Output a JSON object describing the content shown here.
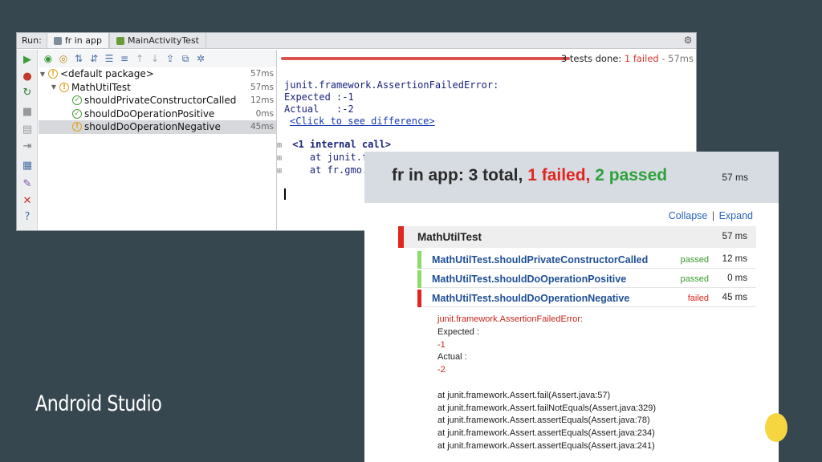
{
  "ide": {
    "run_label": "Run:",
    "tabs": [
      {
        "label": "fr in app"
      },
      {
        "label": "MainActivityTest"
      }
    ],
    "tree": [
      {
        "label": "<default package>",
        "duration": "57ms",
        "level": 0,
        "status": "warn"
      },
      {
        "label": "MathUtilTest",
        "duration": "57ms",
        "level": 1,
        "status": "warn"
      },
      {
        "label": "shouldPrivateConstructorCalled",
        "duration": "12ms",
        "level": 2,
        "status": "ok"
      },
      {
        "label": "shouldDoOperationPositive",
        "duration": "0ms",
        "level": 2,
        "status": "ok"
      },
      {
        "label": "shouldDoOperationNegative",
        "duration": "45ms",
        "level": 2,
        "status": "warn"
      }
    ],
    "progress": {
      "done_text": "3 tests done:",
      "failed_text": "1 failed",
      "time_text": "- 57ms",
      "colors": {
        "bar": "#d9534f"
      }
    },
    "console": {
      "lines": [
        "junit.framework.AssertionFailedError:",
        "Expected :-1",
        "Actual   :-2"
      ],
      "diff_link": "<Click to see difference>",
      "internal_call": "<1 internal call>",
      "stack_lines": [
        "at junit.f",
        "at fr.gmo."
      ]
    }
  },
  "report": {
    "title_prefix": "fr in app: 3 total,",
    "title_failed": "1 failed,",
    "title_passed": "2 passed",
    "total_ms": "57 ms",
    "collapse": "Collapse",
    "separator": "|",
    "expand": "Expand",
    "suite": {
      "name": "MathUtilTest",
      "ms": "57 ms"
    },
    "cases": [
      {
        "name": "MathUtilTest.shouldPrivateConstructorCalled",
        "status": "passed",
        "ms": "12 ms"
      },
      {
        "name": "MathUtilTest.shouldDoOperationPositive",
        "status": "passed",
        "ms": "0 ms"
      },
      {
        "name": "MathUtilTest.shouldDoOperationNegative",
        "status": "failed",
        "ms": "45 ms"
      }
    ],
    "failure": {
      "error": "junit.framework.AssertionFailedError:",
      "expected_label": "Expected :",
      "expected_value": "-1",
      "actual_label": "Actual :",
      "actual_value": "-2",
      "stack": [
        "at junit.framework.Assert.fail(Assert.java:57)",
        "at junit.framework.Assert.failNotEquals(Assert.java:329)",
        "at junit.framework.Assert.assertEquals(Assert.java:78)",
        "at junit.framework.Assert.assertEquals(Assert.java:234)",
        "at junit.framework.Assert.assertEquals(Assert.java:241)"
      ]
    },
    "colors": {
      "failed": "#e0261f",
      "passed": "#2ea13a",
      "link": "#2a66b8"
    }
  },
  "slide": {
    "caption": "Android Studio",
    "colors": {
      "background": "#37474f",
      "accent": "#f5d640"
    }
  }
}
